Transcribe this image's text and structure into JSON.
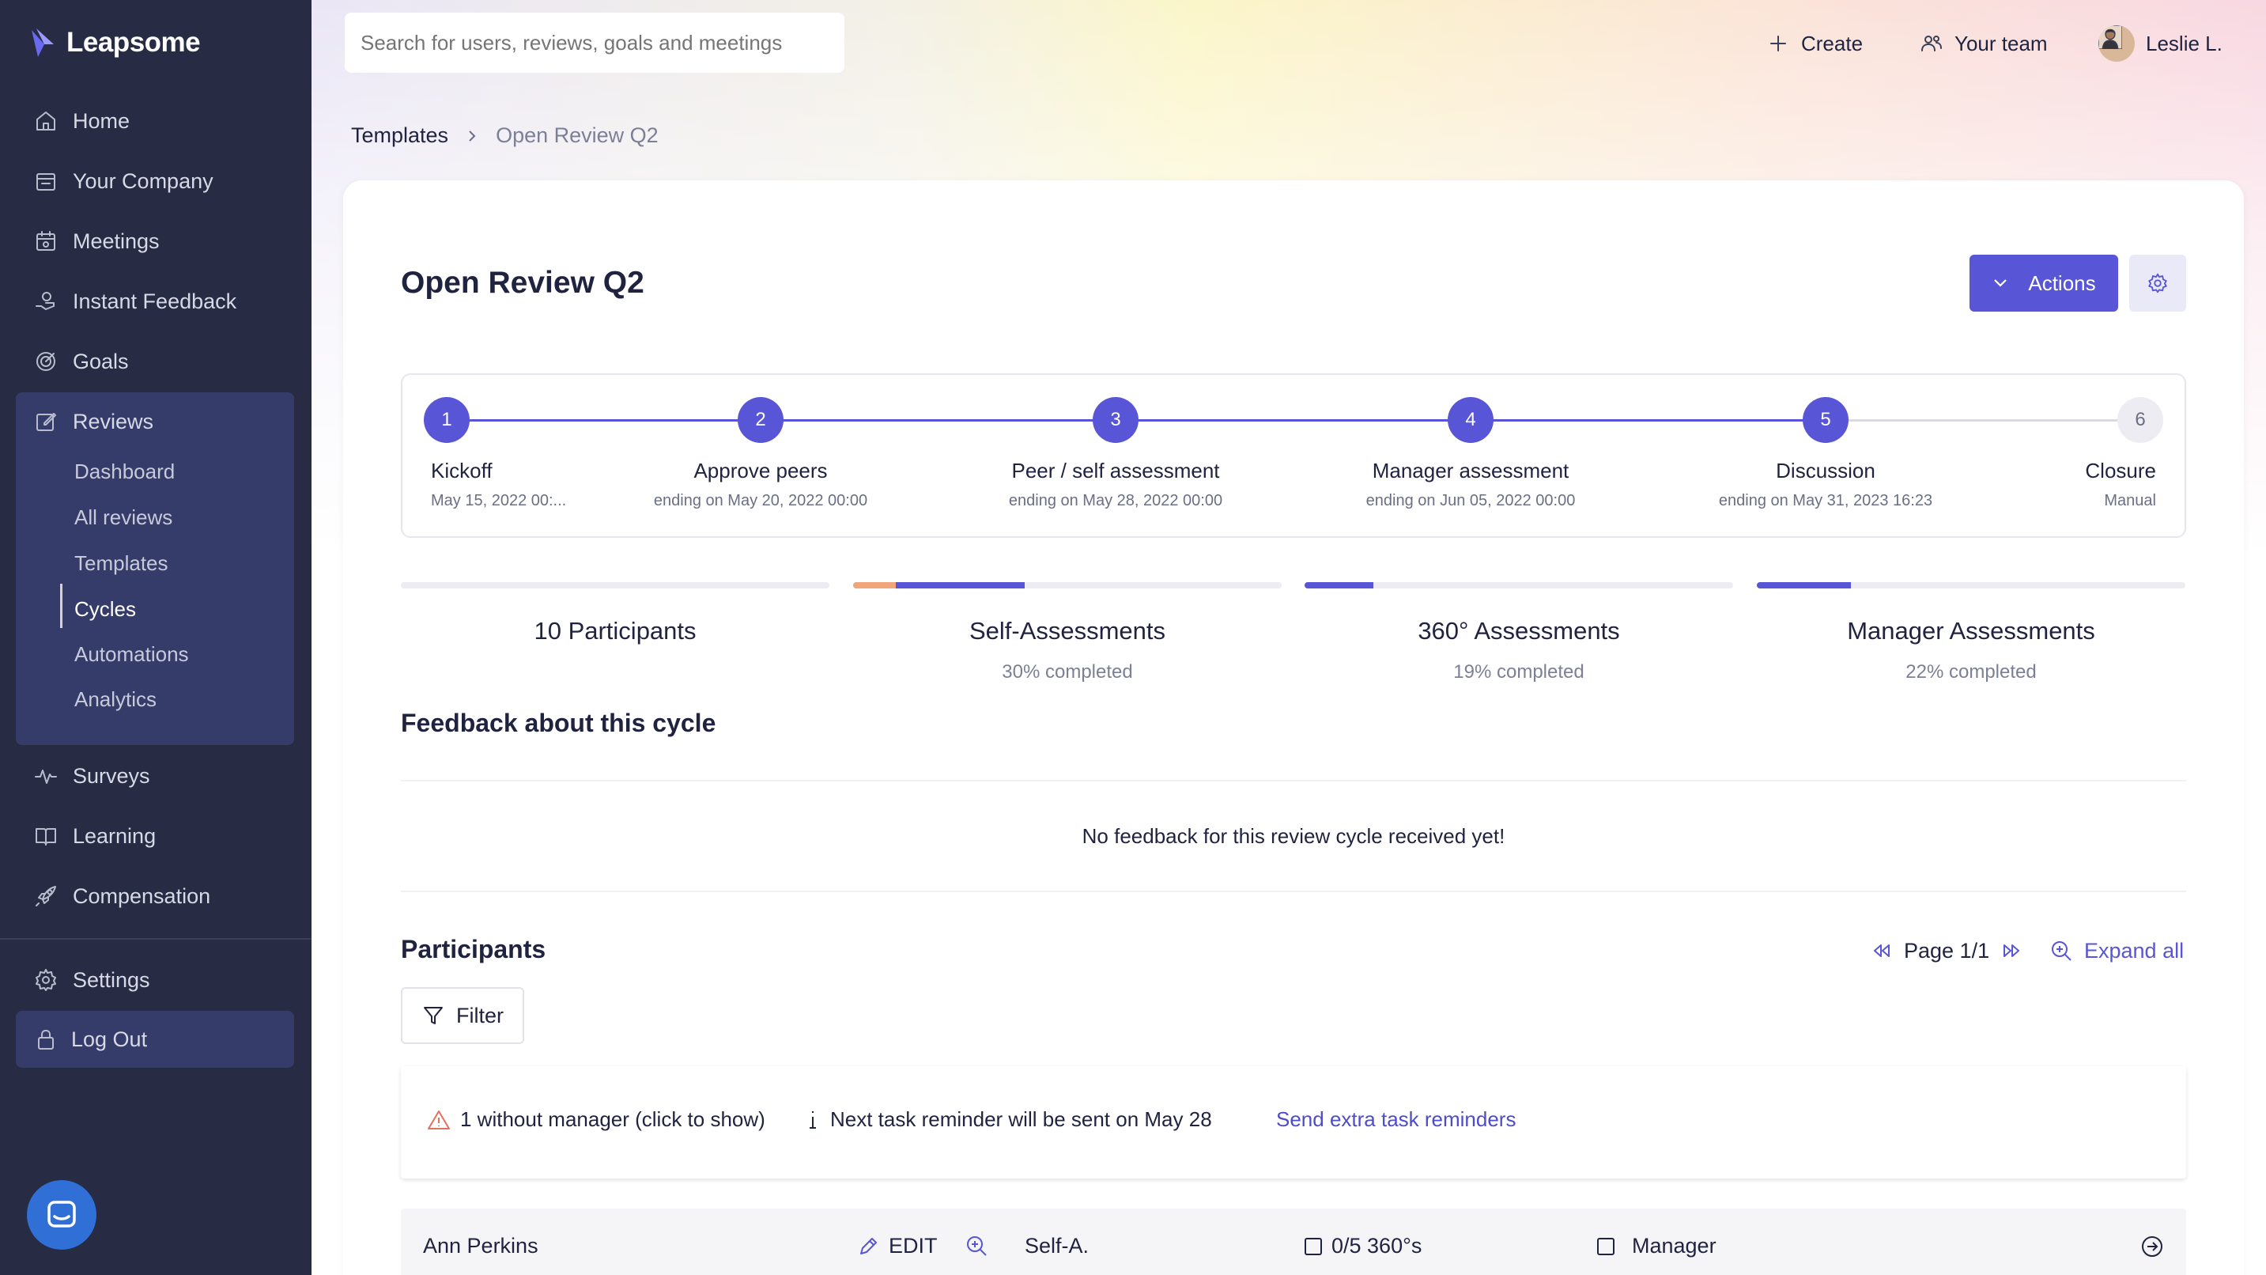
{
  "app": {
    "name": "Leapsome"
  },
  "sidebar": {
    "items": [
      {
        "label": "Home",
        "icon": "home-icon"
      },
      {
        "label": "Your Company",
        "icon": "company-icon"
      },
      {
        "label": "Meetings",
        "icon": "calendar-icon"
      },
      {
        "label": "Instant Feedback",
        "icon": "feedback-icon"
      },
      {
        "label": "Goals",
        "icon": "target-icon"
      },
      {
        "label": "Reviews",
        "icon": "edit-icon"
      },
      {
        "label": "Surveys",
        "icon": "pulse-icon"
      },
      {
        "label": "Learning",
        "icon": "book-icon"
      },
      {
        "label": "Compensation",
        "icon": "rocket-icon"
      },
      {
        "label": "Settings",
        "icon": "gear-icon"
      }
    ],
    "review_sub_items": [
      "Dashboard",
      "All reviews",
      "Templates",
      "Cycles",
      "Automations",
      "Analytics"
    ],
    "active_sub_item": "Cycles",
    "logout_label": "Log Out"
  },
  "topbar": {
    "search_placeholder": "Search for users, reviews, goals and meetings",
    "create_label": "Create",
    "team_label": "Your team",
    "user_name": "Leslie L."
  },
  "breadcrumb": {
    "parent": "Templates",
    "current": "Open Review Q2"
  },
  "page": {
    "title": "Open Review Q2",
    "actions_label": "Actions",
    "accent_color": "#5856d6"
  },
  "steps": [
    {
      "number": "1",
      "title": "Kickoff",
      "subtitle": "May 15, 2022 00:...",
      "done": true
    },
    {
      "number": "2",
      "title": "Approve peers",
      "subtitle": "ending on May 20, 2022 00:00",
      "done": true
    },
    {
      "number": "3",
      "title": "Peer / self assessment",
      "subtitle": "ending on May 28, 2022 00:00",
      "done": true
    },
    {
      "number": "4",
      "title": "Manager assessment",
      "subtitle": "ending on Jun 05, 2022 00:00",
      "done": true
    },
    {
      "number": "5",
      "title": "Discussion",
      "subtitle": "ending on May 31, 2023 16:23",
      "done": true
    },
    {
      "number": "6",
      "title": "Closure",
      "subtitle": "Manual",
      "done": false
    }
  ],
  "stats": [
    {
      "title": "10 Participants",
      "subtitle": "",
      "progress": 0,
      "pending": 0
    },
    {
      "title": "Self-Assessments",
      "subtitle": "30% completed",
      "progress": 0.3,
      "pending": 0.1
    },
    {
      "title": "360° Assessments",
      "subtitle": "19% completed",
      "progress": 0.16,
      "pending": 0
    },
    {
      "title": "Manager Assessments",
      "subtitle": "22% completed",
      "progress": 0.22,
      "pending": 0
    }
  ],
  "feedback": {
    "title": "Feedback about this cycle",
    "empty_message": "No feedback for this review cycle received yet!"
  },
  "participants": {
    "title": "Participants",
    "page_label": "Page 1/1",
    "expand_label": "Expand all",
    "filter_label": "Filter",
    "notice_without_manager": "1 without manager (click to show)",
    "notice_reminder": "Next task reminder will be sent on May 28",
    "notice_send_link": "Send extra task reminders",
    "rows": [
      {
        "name": "Ann Perkins",
        "edit_label": "EDIT",
        "self_label": "Self-A.",
        "peer_label": "0/5 360°s",
        "manager_label": "Manager"
      }
    ]
  }
}
